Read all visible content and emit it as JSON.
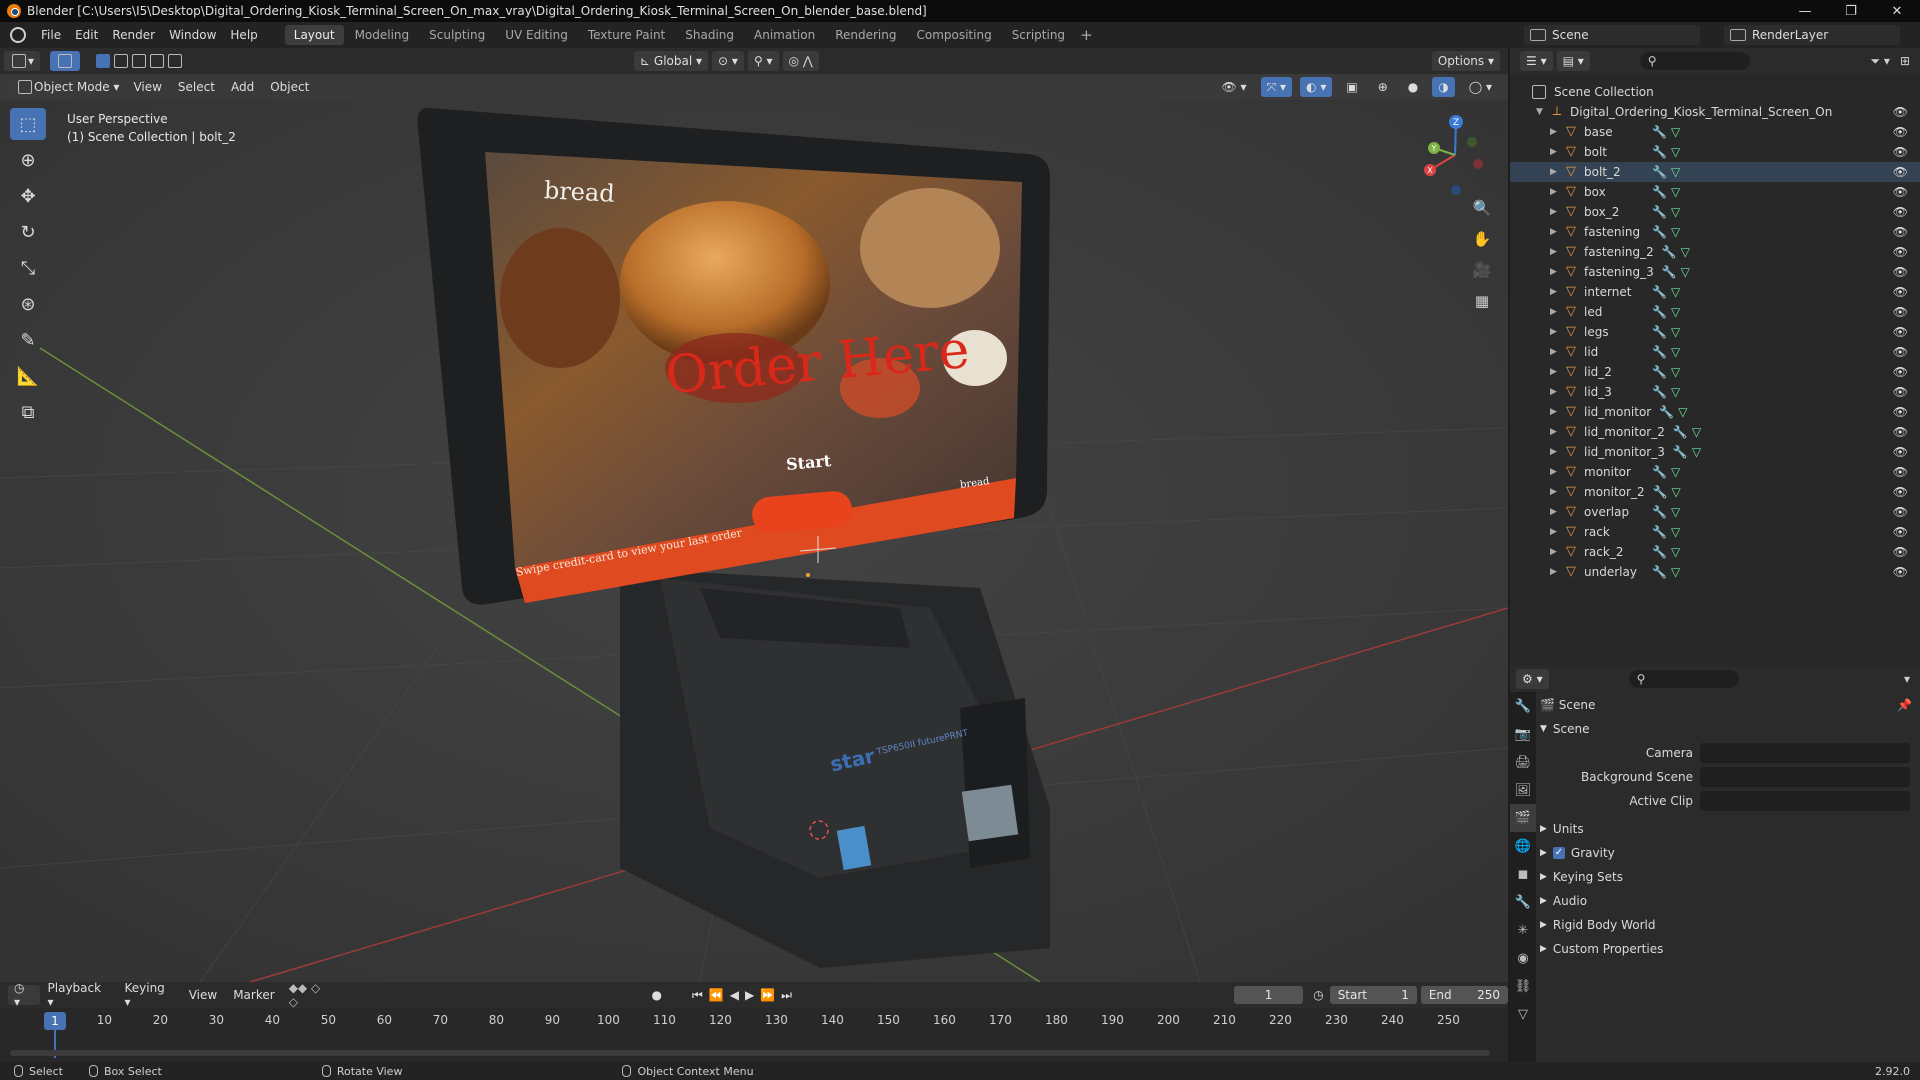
{
  "window": {
    "title": "Blender [C:\\Users\\I5\\Desktop\\Digital_Ordering_Kiosk_Terminal_Screen_On_max_vray\\Digital_Ordering_Kiosk_Terminal_Screen_On_blender_base.blend]",
    "minimize": "—",
    "maximize": "❐",
    "close": "✕"
  },
  "menu": {
    "items": [
      "File",
      "Edit",
      "Render",
      "Window",
      "Help"
    ],
    "workspaces": [
      "Layout",
      "Modeling",
      "Sculpting",
      "UV Editing",
      "Texture Paint",
      "Shading",
      "Animation",
      "Rendering",
      "Compositing",
      "Scripting"
    ],
    "active_workspace": "Layout",
    "add_tab": "+",
    "scene": "Scene",
    "render_layer": "RenderLayer"
  },
  "viewport": {
    "mode": "Object Mode",
    "menus": [
      "View",
      "Select",
      "Add",
      "Object"
    ],
    "transform_orientation": "Global",
    "options": "Options",
    "info_line1": "User Perspective",
    "info_line2": "(1) Scene Collection | bolt_2",
    "gizmo_axes": [
      "X",
      "Y",
      "Z"
    ]
  },
  "screen": {
    "brand": "bread",
    "headline": "Order Here",
    "start_button": "Start",
    "footer": "Swipe credit-card to view your last order",
    "corner_brand": "bread",
    "printer_label": "star",
    "printer_model": "TSP650II futurePRNT"
  },
  "colors": {
    "accent": "#4772b3",
    "orange_button": "#e8431c",
    "headline_red": "#d9281a",
    "mesh_icon": "#e5953a"
  },
  "timeline": {
    "menus": [
      "Playback",
      "Keying",
      "View",
      "Marker"
    ],
    "current_frame": "1",
    "start_label": "Start",
    "start": "1",
    "end_label": "End",
    "end": "250",
    "ticks": [
      "10",
      "20",
      "30",
      "40",
      "50",
      "60",
      "70",
      "80",
      "90",
      "100",
      "110",
      "120",
      "130",
      "140",
      "150",
      "160",
      "170",
      "180",
      "190",
      "200",
      "210",
      "220",
      "230",
      "240",
      "250"
    ]
  },
  "outliner": {
    "root": "Scene Collection",
    "collection": "Digital_Ordering_Kiosk_Terminal_Screen_On",
    "objects": [
      "base",
      "bolt",
      "bolt_2",
      "box",
      "box_2",
      "fastening",
      "fastening_2",
      "fastening_3",
      "internet",
      "led",
      "legs",
      "lid",
      "lid_2",
      "lid_3",
      "lid_monitor",
      "lid_monitor_2",
      "lid_monitor_3",
      "monitor",
      "monitor_2",
      "overlap",
      "rack",
      "rack_2",
      "underlay"
    ]
  },
  "properties": {
    "context": "Scene",
    "panel": "Scene",
    "camera_label": "Camera",
    "background_scene_label": "Background Scene",
    "active_clip_label": "Active Clip",
    "sections": [
      "Units",
      "Gravity",
      "Keying Sets",
      "Audio",
      "Rigid Body World",
      "Custom Properties"
    ]
  },
  "status": {
    "select": "Select",
    "box_select": "Box Select",
    "rotate_view": "Rotate View",
    "context_menu": "Object Context Menu",
    "version": "2.92.0"
  }
}
